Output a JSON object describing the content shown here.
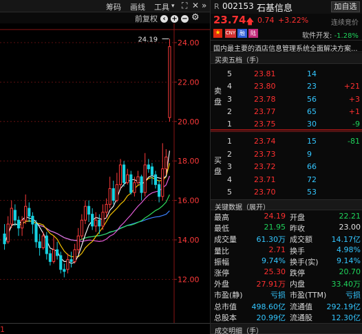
{
  "toolbar": {
    "chips": "筹码",
    "drawing": "画线",
    "tools": "工具",
    "tools_caret": "▾",
    "expand_icon": "⛶",
    "close_icon": "✕",
    "more_icon": "»"
  },
  "subbar": {
    "adjust": "前复权",
    "prev": "‹",
    "plus": "+",
    "minus": "−",
    "gear": "⚙"
  },
  "chart": {
    "high_label": "24.19",
    "y_ticks": [
      "24.00",
      "22.00",
      "20.00",
      "18.00",
      "16.00",
      "14.00",
      "12.00"
    ],
    "bottom_mark": "1",
    "colors": {
      "up": "#ff3b3b",
      "down": "#17d1e0",
      "ma5": "#f0f0f0",
      "ma10": "#f3c200",
      "ma20": "#e45cd9",
      "ma30": "#2fdc5c",
      "ma60": "#3b82ff"
    }
  },
  "stock": {
    "prefix": "R",
    "code": "002153",
    "name": "石基信息",
    "add_button": "加自选",
    "price": "23.74",
    "arrow": "🡅",
    "change": "0.74",
    "change_pct": "+3.22%",
    "status": "连续竞价",
    "tags": [
      "🇨🇳",
      "CNY",
      "融",
      "陆"
    ],
    "sector_label": "软件开发:",
    "sector_change": "-1.28%",
    "description": "国内最主要的酒店信息管理系统全面解决方案..."
  },
  "orderbook": {
    "title": "买卖五档（手）",
    "sell_label": "卖盘",
    "buy_label": "买盘",
    "asks": [
      {
        "level": "5",
        "price": "23.81",
        "qty": "14",
        "chg": ""
      },
      {
        "level": "4",
        "price": "23.80",
        "qty": "23",
        "chg": "+21"
      },
      {
        "level": "3",
        "price": "23.78",
        "qty": "56",
        "chg": "+3"
      },
      {
        "level": "2",
        "price": "23.77",
        "qty": "65",
        "chg": "+1"
      },
      {
        "level": "1",
        "price": "23.75",
        "qty": "30",
        "chg": "-9"
      }
    ],
    "bids": [
      {
        "level": "1",
        "price": "23.74",
        "qty": "15",
        "chg": "-81"
      },
      {
        "level": "2",
        "price": "23.73",
        "qty": "9",
        "chg": ""
      },
      {
        "level": "3",
        "price": "23.72",
        "qty": "66",
        "chg": ""
      },
      {
        "level": "4",
        "price": "23.71",
        "qty": "72",
        "chg": ""
      },
      {
        "level": "5",
        "price": "23.70",
        "qty": "53",
        "chg": ""
      }
    ]
  },
  "keydata": {
    "title": "关键数据（展开）",
    "rows": [
      {
        "l1": "最高",
        "v1": "24.19",
        "c1": "#ff3030",
        "l2": "开盘",
        "v2": "22.21",
        "c2": "#1fd35b"
      },
      {
        "l1": "最低",
        "v1": "21.95",
        "c1": "#1fd35b",
        "l2": "昨收",
        "v2": "23.00",
        "c2": "#e0e0e0"
      },
      {
        "l1": "成交量",
        "v1": "61.30万",
        "c1": "#33c6ff",
        "l2": "成交额",
        "v2": "14.17亿",
        "c2": "#33c6ff"
      },
      {
        "l1": "量比",
        "v1": "2.71",
        "c1": "#ff3030",
        "l2": "换手",
        "v2": "4.98%",
        "c2": "#33c6ff"
      },
      {
        "l1": "振幅",
        "v1": "9.74%",
        "c1": "#33c6ff",
        "l2": "换手(实)",
        "v2": "9.14%",
        "c2": "#33c6ff"
      },
      {
        "l1": "涨停",
        "v1": "25.30",
        "c1": "#ff3030",
        "l2": "跌停",
        "v2": "20.70",
        "c2": "#1fd35b"
      },
      {
        "l1": "外盘",
        "v1": "27.91万",
        "c1": "#ff3030",
        "l2": "内盘",
        "v2": "33.40万",
        "c2": "#1fd35b"
      },
      {
        "l1": "市盈(静)",
        "v1": "亏损",
        "c1": "#33c6ff",
        "l2": "市盈(TTM)",
        "v2": "亏损",
        "c2": "#33c6ff"
      },
      {
        "l1": "总市值",
        "v1": "498.60亿",
        "c1": "#33c6ff",
        "l2": "流通值",
        "v2": "292.19亿",
        "c2": "#33c6ff"
      },
      {
        "l1": "总股本",
        "v1": "20.99亿",
        "c1": "#33c6ff",
        "l2": "流通股",
        "v2": "12.30亿",
        "c2": "#33c6ff"
      }
    ]
  },
  "trades": {
    "title": "成交明细（手）"
  }
}
